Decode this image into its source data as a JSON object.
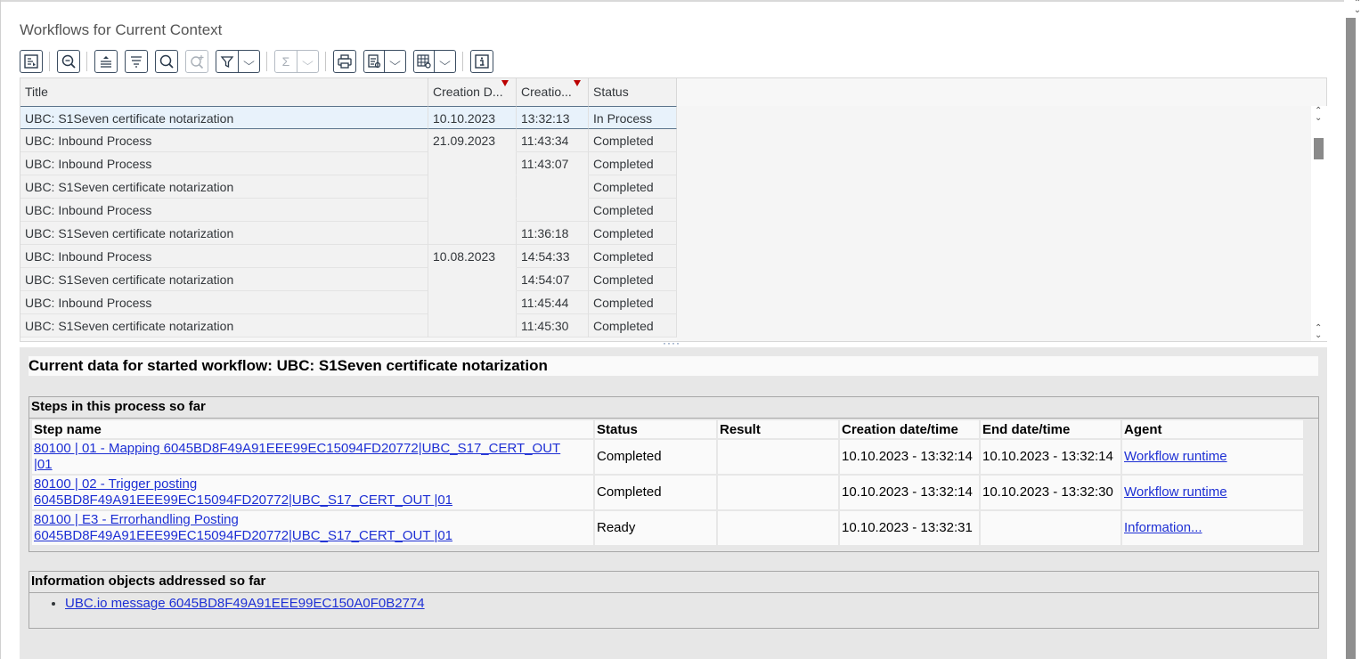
{
  "page": {
    "title": "Workflows for Current Context"
  },
  "toolbar": {
    "buttons": [
      {
        "icon": "details-icon"
      },
      {
        "icon": "zoom-icon"
      },
      {
        "icon": "sort-ascending-icon"
      },
      {
        "icon": "sort-descending-icon"
      },
      {
        "icon": "search-icon"
      },
      {
        "icon": "search-next-icon"
      },
      {
        "icon": "filter-icon"
      },
      {
        "icon": "sum-icon",
        "label": "Σ"
      },
      {
        "icon": "print-icon"
      },
      {
        "icon": "export-icon"
      },
      {
        "icon": "layout-icon"
      },
      {
        "icon": "info-icon"
      }
    ]
  },
  "grid": {
    "columns": [
      "Title",
      "Creation D...",
      "Creatio...",
      "Status"
    ],
    "rows": [
      {
        "title": "UBC: S1Seven certificate notarization",
        "date": "10.10.2023",
        "time": "13:32:13",
        "status": "In Process"
      },
      {
        "title": "UBC: Inbound Process",
        "date": "21.09.2023",
        "time": "11:43:34",
        "status": "Completed"
      },
      {
        "title": "UBC: Inbound Process",
        "date": "",
        "time": "11:43:07",
        "status": "Completed"
      },
      {
        "title": "UBC: S1Seven certificate notarization",
        "date": "",
        "time": "",
        "status": "Completed"
      },
      {
        "title": "UBC: Inbound Process",
        "date": "",
        "time": "",
        "status": "Completed"
      },
      {
        "title": "UBC: S1Seven certificate notarization",
        "date": "",
        "time": "11:36:18",
        "status": "Completed"
      },
      {
        "title": "UBC: Inbound Process",
        "date": "10.08.2023",
        "time": "14:54:33",
        "status": "Completed"
      },
      {
        "title": "UBC: S1Seven certificate notarization",
        "date": "",
        "time": "14:54:07",
        "status": "Completed"
      },
      {
        "title": "UBC: Inbound Process",
        "date": "",
        "time": "11:45:44",
        "status": "Completed"
      },
      {
        "title": "UBC: S1Seven certificate notarization",
        "date": "",
        "time": "11:45:30",
        "status": "Completed"
      }
    ]
  },
  "detail": {
    "heading": "Current data for started workflow: UBC: S1Seven certificate notarization",
    "steps_title": "Steps in this process so far",
    "steps_columns": [
      "Step name",
      "Status",
      "Result",
      "Creation date/time",
      "End date/time",
      "Agent"
    ],
    "steps": [
      {
        "name_line1": "80100 | 01 - Mapping 6045BD8F49A91EEE99EC15094FD20772|UBC_S17_CERT_OUT",
        "name_line2": "|01",
        "status": "Completed",
        "result": "",
        "created": "10.10.2023 - 13:32:14",
        "ended": "10.10.2023 - 13:32:14",
        "agent": "Workflow runtime"
      },
      {
        "name_line1": "80100 | 02 - Trigger posting",
        "name_line2": "6045BD8F49A91EEE99EC15094FD20772|UBC_S17_CERT_OUT |01",
        "status": "Completed",
        "result": "",
        "created": "10.10.2023 - 13:32:14",
        "ended": "10.10.2023 - 13:32:30",
        "agent": "Workflow runtime"
      },
      {
        "name_line1": "80100 | E3 - Errorhandling Posting",
        "name_line2": "6045BD8F49A91EEE99EC15094FD20772|UBC_S17_CERT_OUT |01",
        "status": "Ready",
        "result": "",
        "created": "10.10.2023 - 13:32:31",
        "ended": "",
        "agent": "Information..."
      }
    ],
    "info_title": "Information objects addressed so far",
    "info_items": [
      "UBC.io message 6045BD8F49A91EEE99EC150A0F0B2774"
    ]
  }
}
